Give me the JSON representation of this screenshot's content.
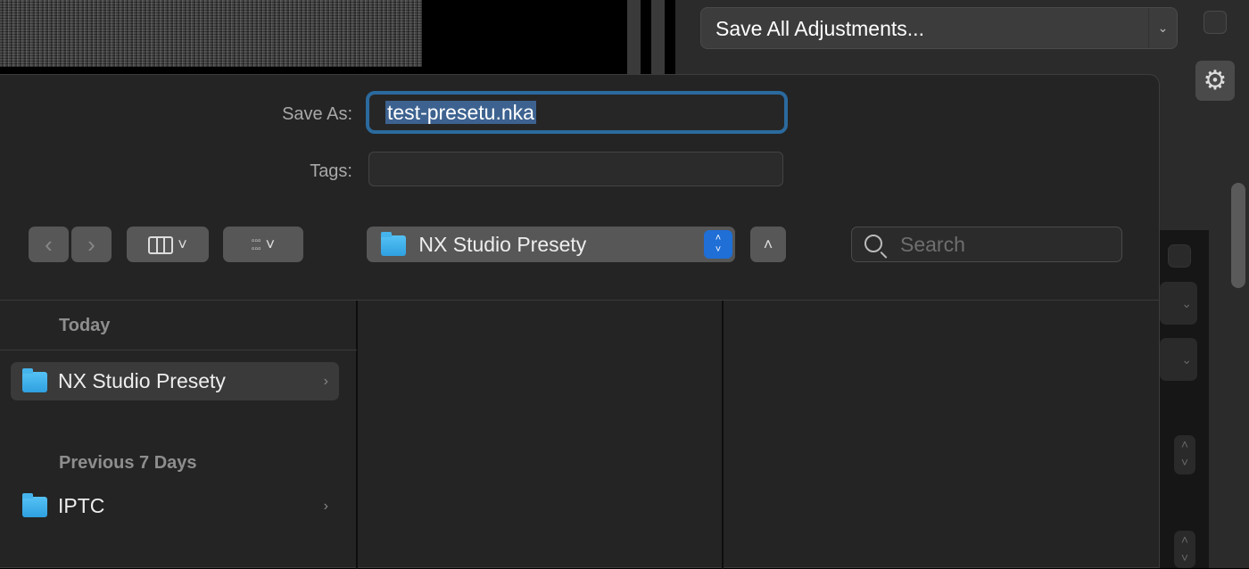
{
  "background": {
    "adjustments_menu": {
      "label": "Save All Adjustments...",
      "icon": "chevron-down-icon"
    },
    "gear_icon": "gear-icon"
  },
  "dialog": {
    "save_as": {
      "label": "Save As:",
      "value": "test-presetu.nka"
    },
    "tags": {
      "label": "Tags:",
      "value": ""
    },
    "toolbar": {
      "back_icon": "chevron-left-icon",
      "forward_icon": "chevron-right-icon",
      "view_icon": "columns-view-icon",
      "group_icon": "grid-group-icon",
      "location": "NX Studio Presety",
      "expand_icon": "chevron-up-icon"
    },
    "search": {
      "placeholder": "Search",
      "value": ""
    },
    "sidebar": {
      "sections": [
        {
          "title": "Today",
          "items": [
            {
              "label": "NX Studio Presety",
              "selected": true
            }
          ]
        },
        {
          "title": "Previous 7 Days",
          "items": [
            {
              "label": "IPTC",
              "selected": false
            }
          ]
        }
      ]
    },
    "colors": {
      "focus_ring": "#2b6a9e",
      "selection": "#3d6290",
      "accent": "#1f6fd6",
      "folder": "#45b4ec"
    }
  }
}
